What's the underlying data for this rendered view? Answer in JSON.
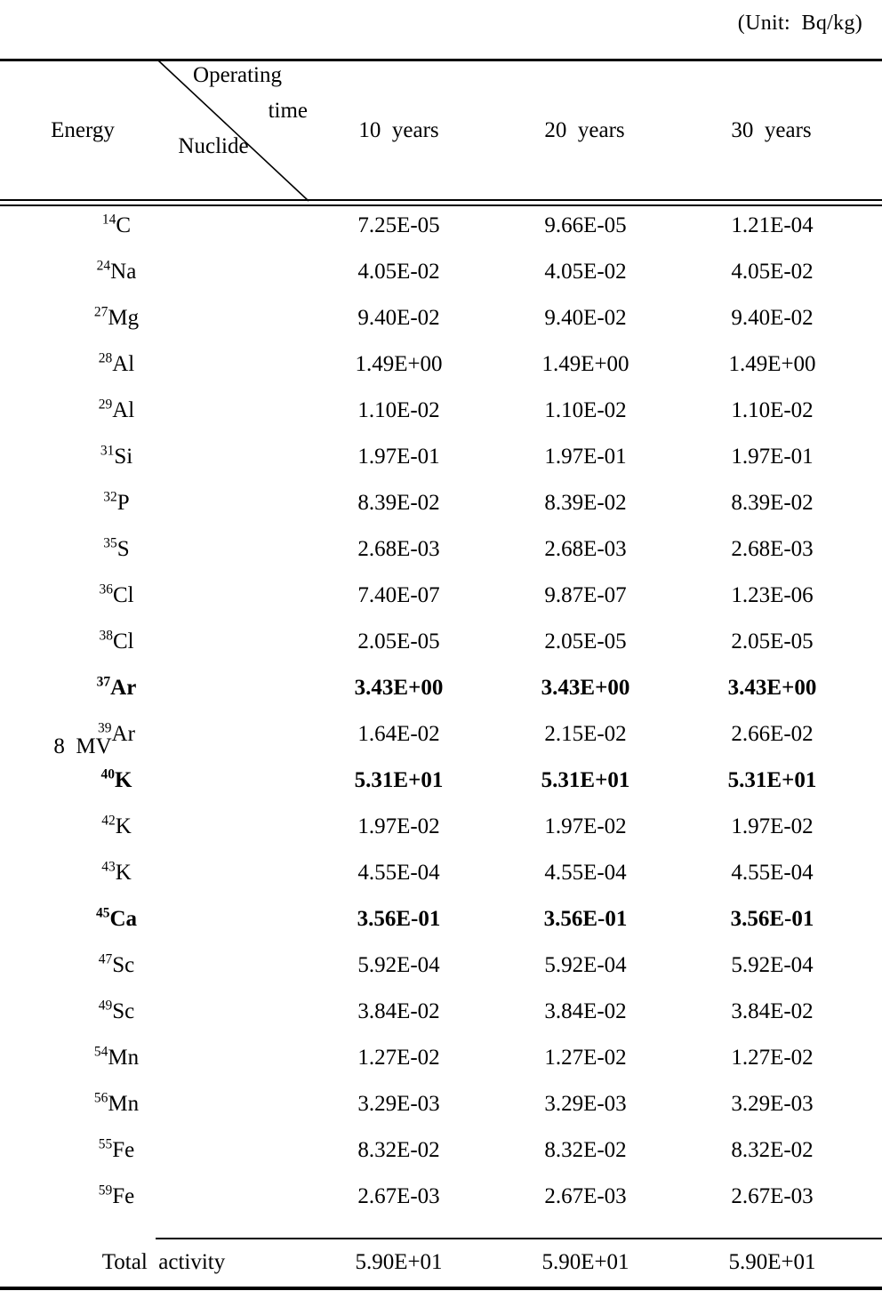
{
  "caption": {
    "unit_note": "(Unit:  Bq/kg)"
  },
  "header": {
    "energy_label": "Energy",
    "operating_label": "Operating",
    "time_label": "time",
    "nuclide_label": "Nuclide",
    "columns": [
      "10  years",
      "20  years",
      "30  years"
    ]
  },
  "energy_group": {
    "label": "8  MV"
  },
  "footer": {
    "total_label": "Total  activity",
    "total_values": [
      "5.90E+01",
      "5.90E+01",
      "5.90E+01"
    ]
  },
  "rows": [
    {
      "mass": "14",
      "element": "C",
      "bold": false,
      "values": [
        "7.25E-05",
        "9.66E-05",
        "1.21E-04"
      ]
    },
    {
      "mass": "24",
      "element": "Na",
      "bold": false,
      "values": [
        "4.05E-02",
        "4.05E-02",
        "4.05E-02"
      ]
    },
    {
      "mass": "27",
      "element": "Mg",
      "bold": false,
      "values": [
        "9.40E-02",
        "9.40E-02",
        "9.40E-02"
      ]
    },
    {
      "mass": "28",
      "element": "Al",
      "bold": false,
      "values": [
        "1.49E+00",
        "1.49E+00",
        "1.49E+00"
      ]
    },
    {
      "mass": "29",
      "element": "Al",
      "bold": false,
      "values": [
        "1.10E-02",
        "1.10E-02",
        "1.10E-02"
      ]
    },
    {
      "mass": "31",
      "element": "Si",
      "bold": false,
      "values": [
        "1.97E-01",
        "1.97E-01",
        "1.97E-01"
      ]
    },
    {
      "mass": "32",
      "element": "P",
      "bold": false,
      "values": [
        "8.39E-02",
        "8.39E-02",
        "8.39E-02"
      ]
    },
    {
      "mass": "35",
      "element": "S",
      "bold": false,
      "values": [
        "2.68E-03",
        "2.68E-03",
        "2.68E-03"
      ]
    },
    {
      "mass": "36",
      "element": "Cl",
      "bold": false,
      "values": [
        "7.40E-07",
        "9.87E-07",
        "1.23E-06"
      ]
    },
    {
      "mass": "38",
      "element": "Cl",
      "bold": false,
      "values": [
        "2.05E-05",
        "2.05E-05",
        "2.05E-05"
      ]
    },
    {
      "mass": "37",
      "element": "Ar",
      "bold": true,
      "values": [
        "3.43E+00",
        "3.43E+00",
        "3.43E+00"
      ]
    },
    {
      "mass": "39",
      "element": "Ar",
      "bold": false,
      "values": [
        "1.64E-02",
        "2.15E-02",
        "2.66E-02"
      ]
    },
    {
      "mass": "40",
      "element": "K",
      "bold": true,
      "values": [
        "5.31E+01",
        "5.31E+01",
        "5.31E+01"
      ]
    },
    {
      "mass": "42",
      "element": "K",
      "bold": false,
      "values": [
        "1.97E-02",
        "1.97E-02",
        "1.97E-02"
      ]
    },
    {
      "mass": "43",
      "element": "K",
      "bold": false,
      "values": [
        "4.55E-04",
        "4.55E-04",
        "4.55E-04"
      ]
    },
    {
      "mass": "45",
      "element": "Ca",
      "bold": true,
      "values": [
        "3.56E-01",
        "3.56E-01",
        "3.56E-01"
      ]
    },
    {
      "mass": "47",
      "element": "Sc",
      "bold": false,
      "values": [
        "5.92E-04",
        "5.92E-04",
        "5.92E-04"
      ]
    },
    {
      "mass": "49",
      "element": "Sc",
      "bold": false,
      "values": [
        "3.84E-02",
        "3.84E-02",
        "3.84E-02"
      ]
    },
    {
      "mass": "54",
      "element": "Mn",
      "bold": false,
      "values": [
        "1.27E-02",
        "1.27E-02",
        "1.27E-02"
      ]
    },
    {
      "mass": "56",
      "element": "Mn",
      "bold": false,
      "values": [
        "3.29E-03",
        "3.29E-03",
        "3.29E-03"
      ]
    },
    {
      "mass": "55",
      "element": "Fe",
      "bold": false,
      "values": [
        "8.32E-02",
        "8.32E-02",
        "8.32E-02"
      ]
    },
    {
      "mass": "59",
      "element": "Fe",
      "bold": false,
      "values": [
        "2.67E-03",
        "2.67E-03",
        "2.67E-03"
      ]
    }
  ]
}
